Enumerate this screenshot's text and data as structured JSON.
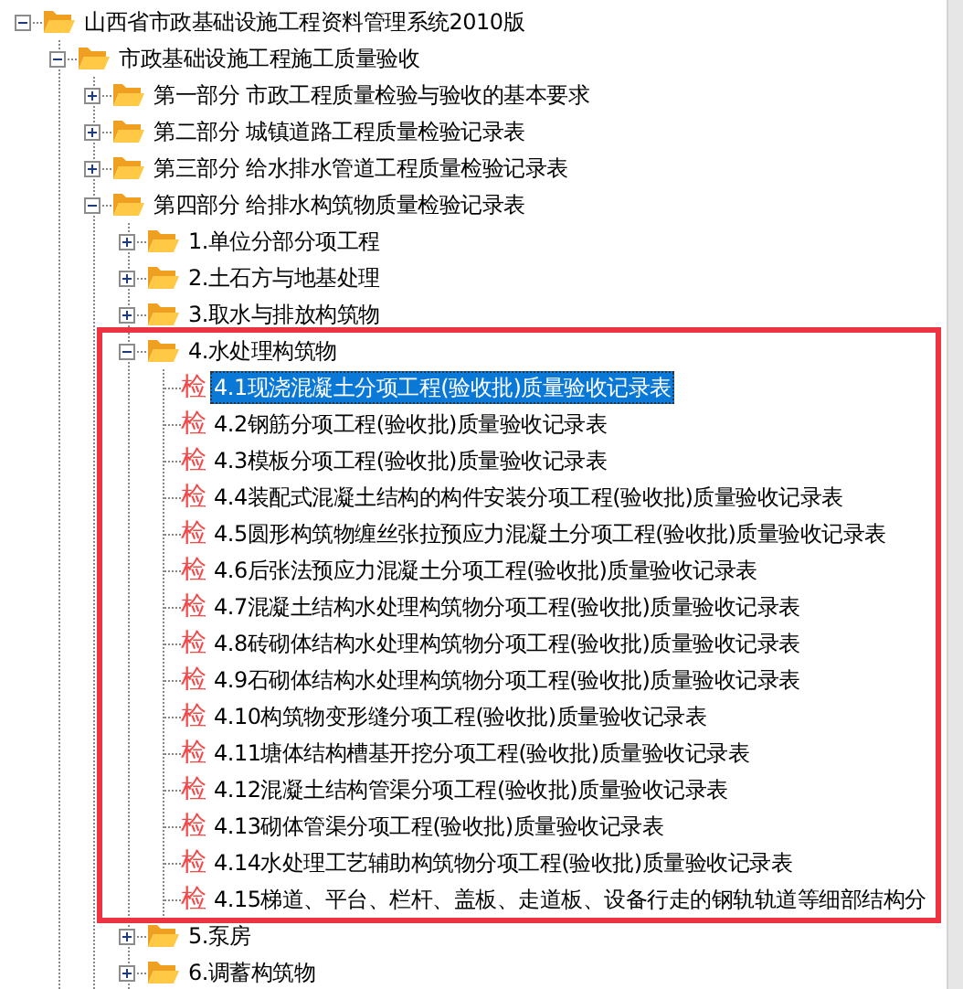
{
  "tree": {
    "label": "山西省市政基础设施工程资料管理系统2010版",
    "kind": "folder",
    "expanded": true,
    "children": [
      {
        "label": "市政基础设施工程施工质量验收",
        "kind": "folder",
        "expanded": true,
        "children": [
          {
            "label": "第一部分 市政工程质量检验与验收的基本要求",
            "kind": "folder",
            "expanded": false
          },
          {
            "label": "第二部分 城镇道路工程质量检验记录表",
            "kind": "folder",
            "expanded": false
          },
          {
            "label": "第三部分 给水排水管道工程质量检验记录表",
            "kind": "folder",
            "expanded": false
          },
          {
            "label": "第四部分 给排水构筑物质量检验记录表",
            "kind": "folder",
            "expanded": true,
            "children": [
              {
                "label": "1.单位分部分项工程",
                "kind": "folder",
                "expanded": false
              },
              {
                "label": "2.土石方与地基处理",
                "kind": "folder",
                "expanded": false
              },
              {
                "label": "3.取水与排放构筑物",
                "kind": "folder",
                "expanded": false
              },
              {
                "label": "4.水处理构筑物",
                "kind": "folder",
                "expanded": true,
                "highlighted": true,
                "children": [
                  {
                    "label": "4.1现浇混凝土分项工程(验收批)质量验收记录表",
                    "kind": "leaf",
                    "icon": "检",
                    "selected": true
                  },
                  {
                    "label": "4.2钢筋分项工程(验收批)质量验收记录表",
                    "kind": "leaf",
                    "icon": "检",
                    "selected": false
                  },
                  {
                    "label": "4.3模板分项工程(验收批)质量验收记录表",
                    "kind": "leaf",
                    "icon": "检",
                    "selected": false
                  },
                  {
                    "label": "4.4装配式混凝土结构的构件安装分项工程(验收批)质量验收记录表",
                    "kind": "leaf",
                    "icon": "检",
                    "selected": false
                  },
                  {
                    "label": "4.5圆形构筑物缠丝张拉预应力混凝土分项工程(验收批)质量验收记录表",
                    "kind": "leaf",
                    "icon": "检",
                    "selected": false
                  },
                  {
                    "label": "4.6后张法预应力混凝土分项工程(验收批)质量验收记录表",
                    "kind": "leaf",
                    "icon": "检",
                    "selected": false
                  },
                  {
                    "label": "4.7混凝土结构水处理构筑物分项工程(验收批)质量验收记录表",
                    "kind": "leaf",
                    "icon": "检",
                    "selected": false
                  },
                  {
                    "label": "4.8砖砌体结构水处理构筑物分项工程(验收批)质量验收记录表",
                    "kind": "leaf",
                    "icon": "检",
                    "selected": false
                  },
                  {
                    "label": "4.9石砌体结构水处理构筑物分项工程(验收批)质量验收记录表",
                    "kind": "leaf",
                    "icon": "检",
                    "selected": false
                  },
                  {
                    "label": "4.10构筑物变形缝分项工程(验收批)质量验收记录表",
                    "kind": "leaf",
                    "icon": "检",
                    "selected": false
                  },
                  {
                    "label": "4.11塘体结构槽基开挖分项工程(验收批)质量验收记录表",
                    "kind": "leaf",
                    "icon": "检",
                    "selected": false
                  },
                  {
                    "label": "4.12混凝土结构管渠分项工程(验收批)质量验收记录表",
                    "kind": "leaf",
                    "icon": "检",
                    "selected": false
                  },
                  {
                    "label": "4.13砌体管渠分项工程(验收批)质量验收记录表",
                    "kind": "leaf",
                    "icon": "检",
                    "selected": false
                  },
                  {
                    "label": "4.14水处理工艺辅助构筑物分项工程(验收批)质量验收记录表",
                    "kind": "leaf",
                    "icon": "检",
                    "selected": false
                  },
                  {
                    "label": "4.15梯道、平台、栏杆、盖板、走道板、设备行走的钢轨轨道等细部结构分",
                    "kind": "leaf",
                    "icon": "检",
                    "selected": false
                  }
                ]
              },
              {
                "label": "5.泵房",
                "kind": "folder",
                "expanded": false
              },
              {
                "label": "6.调蓄构筑物",
                "kind": "folder",
                "expanded": false
              }
            ]
          }
        ]
      }
    ]
  }
}
